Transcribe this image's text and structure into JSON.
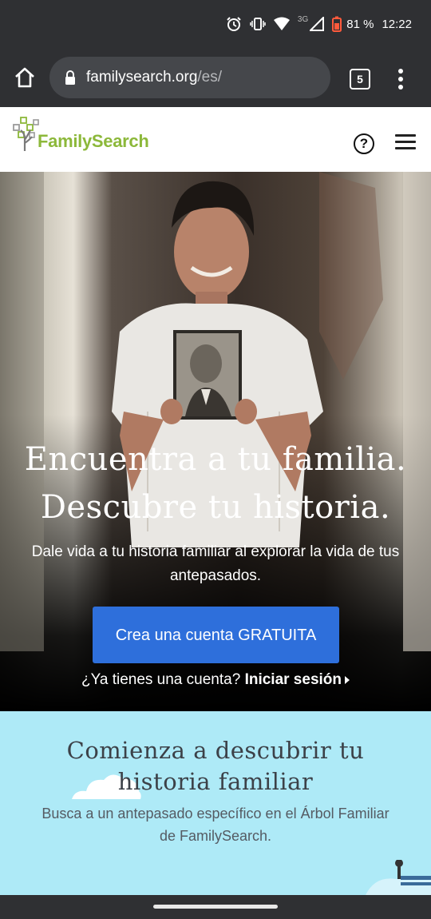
{
  "status_bar": {
    "network": "3G",
    "battery": "81 %",
    "time": "12:22"
  },
  "browser": {
    "url_domain": "familysearch.org",
    "url_path": "/es/",
    "tab_count": "5"
  },
  "header": {
    "logo_text": "FamilySearch",
    "help_label": "?"
  },
  "hero": {
    "title_line1": "Encuentra a tu familia.",
    "title_line2": "Descubre tu historia.",
    "subtitle": "Dale vida a tu historia familiar al explorar la vida de tus antepasados.",
    "cta_label": "Crea una cuenta GRATUITA",
    "signin_prompt": "¿Ya tienes una cuenta? ",
    "signin_link": "Iniciar sesión"
  },
  "discover": {
    "title": "Comienza a descubrir tu historia familiar",
    "subtitle": "Busca a un antepasado específico en el Árbol Familiar de FamilySearch."
  },
  "colors": {
    "brand_green": "#8cb83a",
    "cta_blue": "#2e6fdb",
    "discover_bg": "#aeeaf7",
    "chrome_dark": "#2f3033"
  }
}
